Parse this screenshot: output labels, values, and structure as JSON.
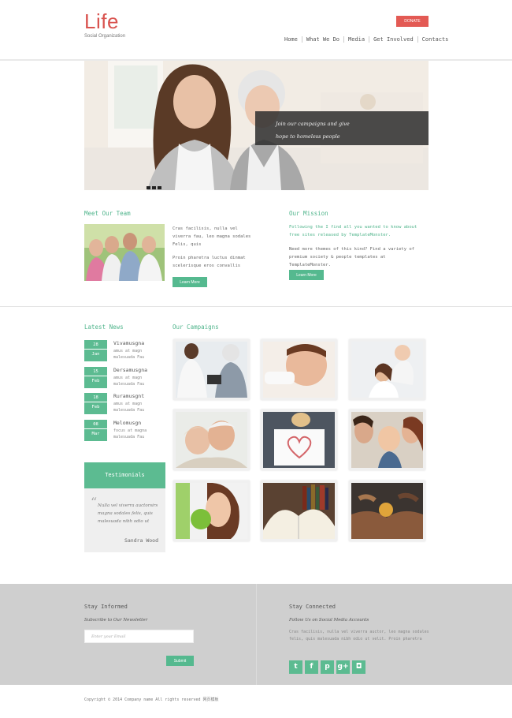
{
  "header": {
    "logo": "Life",
    "tagline": "Social Organization",
    "donate_label": "DONATE",
    "nav": [
      "Home",
      "What We Do",
      "Media",
      "Get Involved",
      "Contacts"
    ]
  },
  "hero": {
    "caption_line1": "Join our campaigns and give",
    "caption_line2": "hope to homeless people"
  },
  "team": {
    "title": "Meet Our Team",
    "para1": "Cras facilisis, nulla vel viverra fau, leo magna sodales Felis, quis",
    "para2": "Proin pharetra luctus dinmat scelerisque eros convallis",
    "button": "Learn More"
  },
  "mission": {
    "title": "Our Mission",
    "para1": "Following the I find all you wanted to know about free sites released by TemplateMonster.",
    "para2": "Need more themes of this kind? Find a variety of premium society & people templates at TemplateMonster.",
    "button": "Learn More"
  },
  "news": {
    "title": "Latest News",
    "items": [
      {
        "day": "28",
        "month": "Jan",
        "title": "Vivamusgna",
        "desc": "amus at magn malesuada Fau"
      },
      {
        "day": "15",
        "month": "Feb",
        "title": "Dersamusgna",
        "desc": "amus at magn malesuada Fau"
      },
      {
        "day": "18",
        "month": "Feb",
        "title": "Ruramusgnt",
        "desc": "amus at magn malesuada Fau"
      },
      {
        "day": "08",
        "month": "Mar",
        "title": "Melomusgn",
        "desc": "focus at magna malesuada Fau"
      }
    ]
  },
  "testimonials": {
    "title": "Testimonials",
    "quote": "Nulla vel viverra auctorsirs magna sodales felis, quis malesuada nibh odio ut",
    "author": "Sandra Wood"
  },
  "campaigns": {
    "title": "Our Campaigns"
  },
  "footer": {
    "left_title": "Stay Informed",
    "left_sub": "Subscribe to Our Newsletter",
    "email_placeholder": "Enter your Email",
    "submit": "Submit",
    "right_title": "Stay Connected",
    "right_sub": "Follow Us on Social Media Accounts",
    "right_text": "Cras facilisis, nulla vel viverra auctor, leo magna sodales felis, quis malesuada nibh odio ut velit. Proin pharetra",
    "social": [
      "t",
      "f",
      "p",
      "g+",
      "◘"
    ]
  },
  "copyright": "Copyright © 2014 Company name All rights reserved 网页模板"
}
